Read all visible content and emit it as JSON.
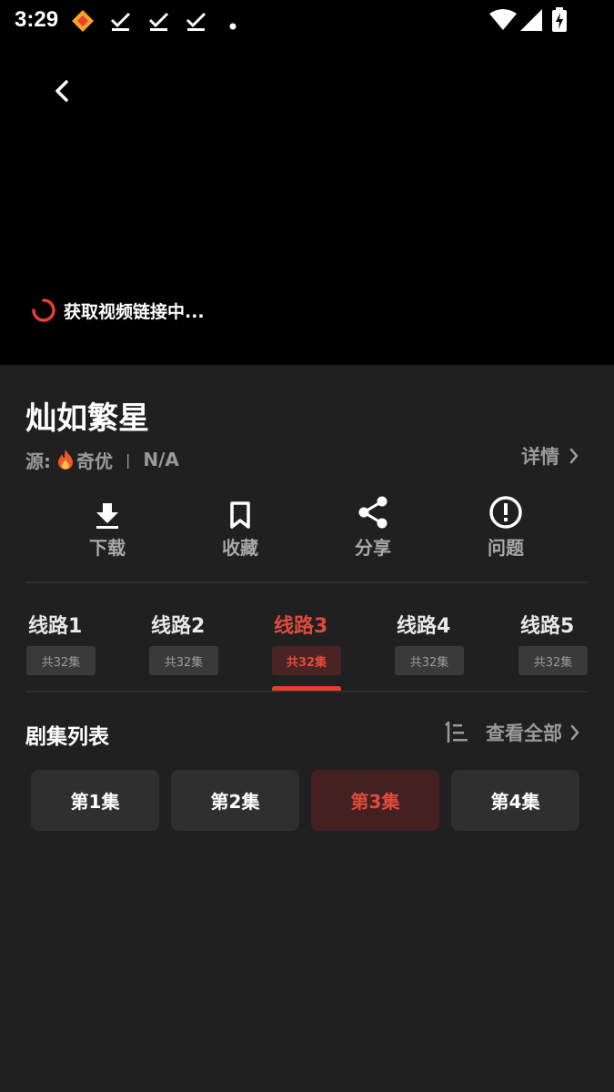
{
  "status_bar": {
    "time": "3:29",
    "icons": [
      "app-notification-icon",
      "download-done-icon",
      "download-done-icon",
      "download-done-icon",
      "dot-icon",
      "wifi-icon",
      "signal-icon",
      "battery-charging-icon"
    ]
  },
  "player": {
    "loading_text": "获取视频链接中..."
  },
  "show": {
    "title": "灿如繁星",
    "source_label": "源:",
    "source_name": "奇优",
    "separator": "|",
    "rating": "N/A",
    "detail_label": "详情"
  },
  "actions": [
    {
      "label": "下载",
      "icon": "download-icon"
    },
    {
      "label": "收藏",
      "icon": "bookmark-icon"
    },
    {
      "label": "分享",
      "icon": "share-icon"
    },
    {
      "label": "问题",
      "icon": "alert-icon"
    }
  ],
  "routes": [
    {
      "name": "线路1",
      "count": "共32集",
      "active": false
    },
    {
      "name": "线路2",
      "count": "共32集",
      "active": false
    },
    {
      "name": "线路3",
      "count": "共32集",
      "active": true
    },
    {
      "name": "线路4",
      "count": "共32集",
      "active": false
    },
    {
      "name": "线路5",
      "count": "共32集",
      "active": false
    }
  ],
  "episode_list": {
    "title": "剧集列表",
    "view_all": "查看全部",
    "episodes": [
      {
        "label": "第1集",
        "active": false
      },
      {
        "label": "第2集",
        "active": false
      },
      {
        "label": "第3集",
        "active": true
      },
      {
        "label": "第4集",
        "active": false
      }
    ]
  },
  "colors": {
    "accent": "#e5402e",
    "background": "#202020",
    "player_bg": "#000000",
    "muted_text": "#9a9a9a",
    "chip_bg": "#2f2f2f",
    "chip_active_bg": "#452020"
  }
}
